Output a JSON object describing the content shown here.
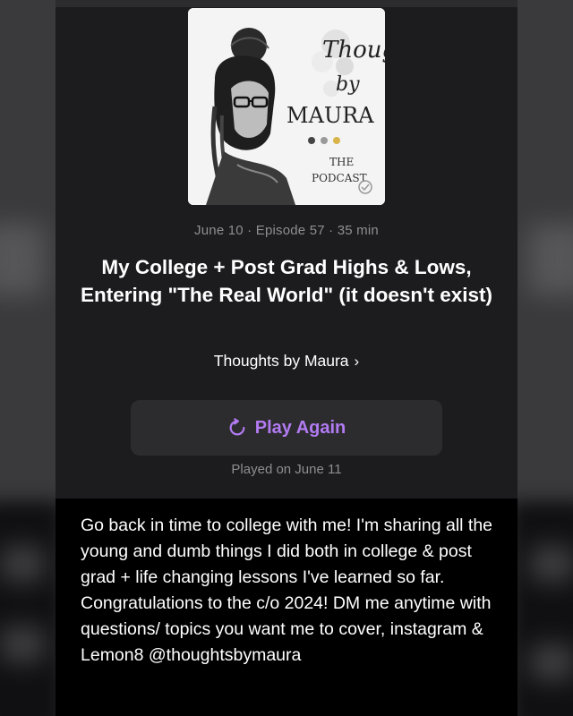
{
  "colors": {
    "accent": "#b27bf2",
    "panel_bg": "#1c1c1e",
    "button_bg": "#2c2c2e",
    "secondary_text": "#8e8e93",
    "description_bg": "#000000"
  },
  "artwork": {
    "title_line1": "Thoughts",
    "title_line2": "by",
    "title_line3": "MAURA",
    "subtitle_line1": "THE",
    "subtitle_line2": "PODCAST"
  },
  "episode": {
    "meta": "June 10 · Episode 57 · 35 min",
    "title": "My College + Post Grad Highs & Lows, Entering \"The Real World\" (it doesn't exist)",
    "show_name": "Thoughts by Maura",
    "show_chevron_icon": "chevron-right-icon"
  },
  "playback": {
    "button_label": "Play Again",
    "button_icon": "replay-icon",
    "played_on": "Played on June 11"
  },
  "description": "Go back in time to college with me! I'm sharing all the young and dumb things I did both in college & post grad + life changing lessons I've learned so far. Congratulations to the c/o 2024! DM me anytime with questions/ topics you want me to cover, instagram & Lemon8 @thoughtsbymaura"
}
